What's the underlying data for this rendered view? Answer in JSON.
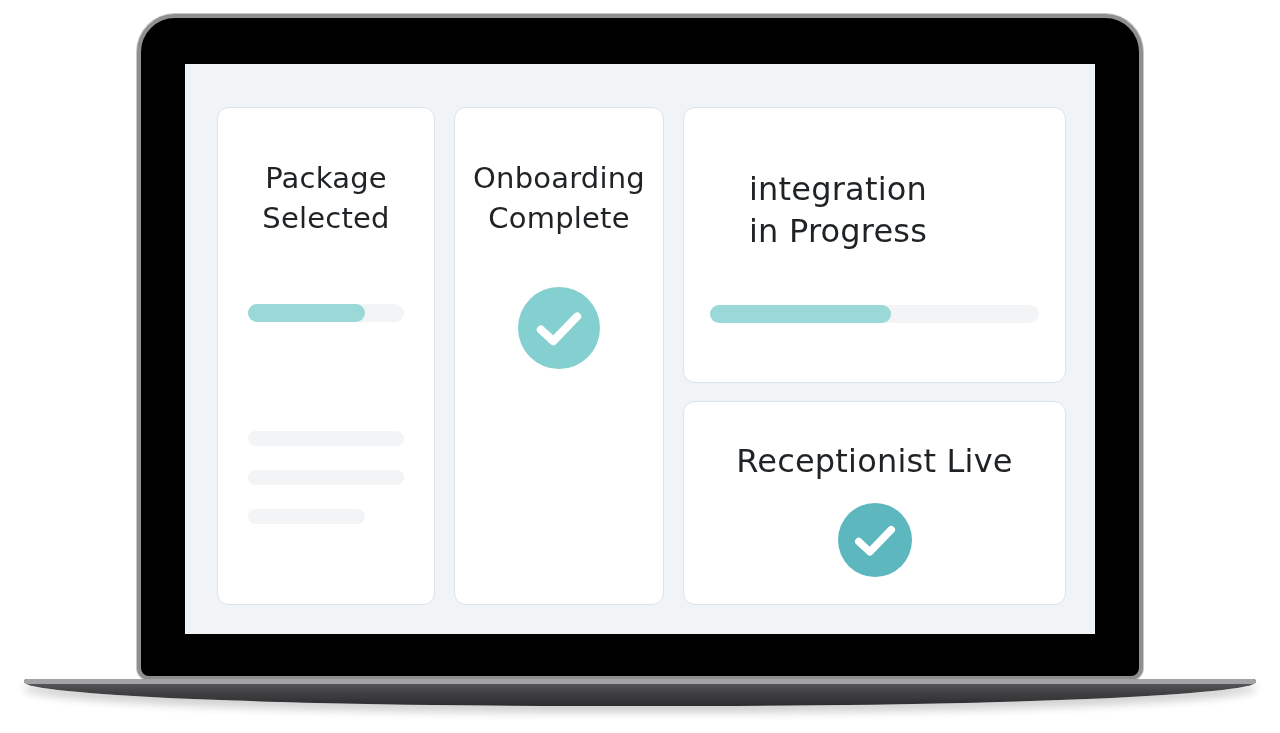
{
  "cards": [
    {
      "kind": "progress",
      "title": "Package Selected",
      "level": 0.75,
      "placeholder_lines": [
        {
          "kind": "full"
        },
        {
          "kind": "full"
        },
        {
          "kind": "short"
        }
      ]
    },
    {
      "kind": "check",
      "title": "Onboarding Complete",
      "color": "#84cfd0"
    },
    {
      "kind": "progress",
      "title": "integration in Progress",
      "level": 0.55
    },
    {
      "kind": "check",
      "title": "Receptionist Live",
      "color": "#5cb8be"
    }
  ]
}
